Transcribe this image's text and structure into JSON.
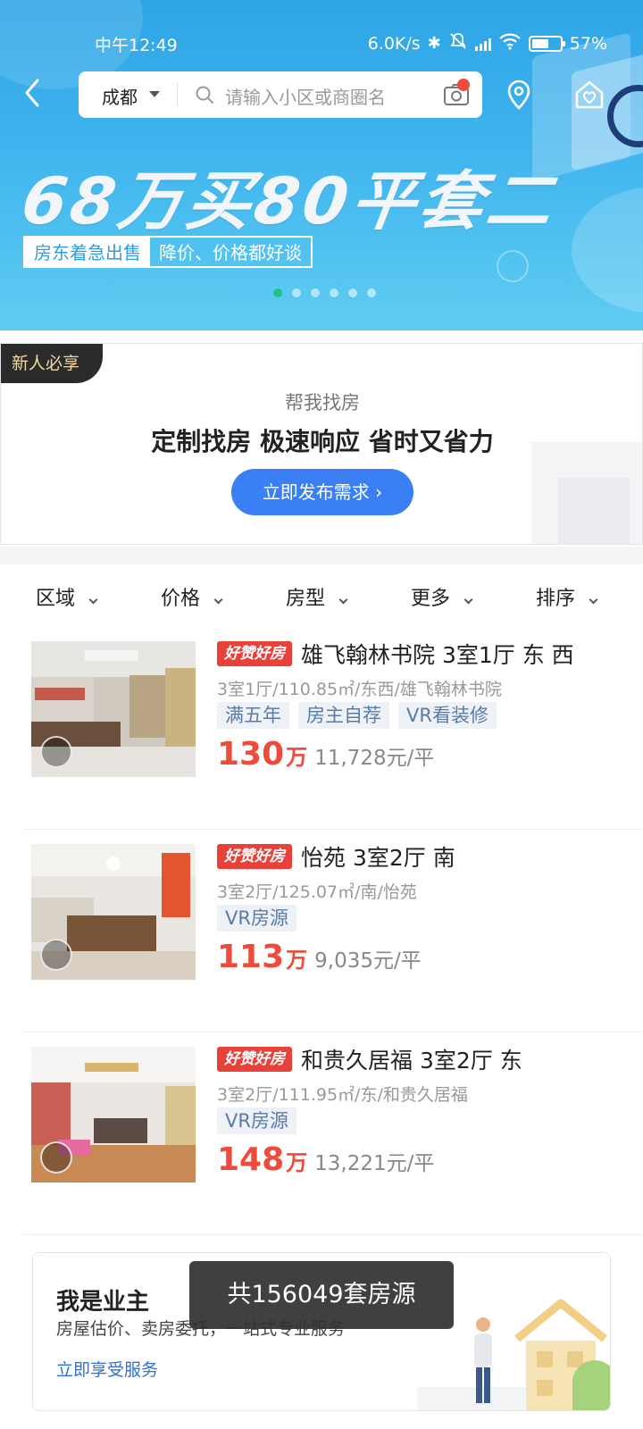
{
  "status_bar": {
    "time": "中午12:49",
    "net_speed": "6.0K/s",
    "battery": "57%"
  },
  "header": {
    "city": "成都",
    "search_placeholder": "请输入小区或商圈名"
  },
  "banner": {
    "headline": "68万买80平套二",
    "tag_left": "房东着急出售",
    "tag_right": "降价、价格都好谈",
    "carousel_total": 6,
    "carousel_active": 1
  },
  "promo": {
    "badge": "新人必享",
    "subtitle": "帮我找房",
    "title": "定制找房 极速响应 省时又省力",
    "button": "立即发布需求 ›"
  },
  "filters": [
    "区域",
    "价格",
    "房型",
    "更多",
    "排序"
  ],
  "listings": [
    {
      "badge": "好赞好房",
      "title": "雄飞翰林书院 3室1厅 东 西",
      "meta": "3室1厅/110.85㎡/东西/雄飞翰林书院",
      "tags": [
        "满五年",
        "房主自荐",
        "VR看装修"
      ],
      "price": "130",
      "price_unit": "万",
      "unit_price": "11,728元/平"
    },
    {
      "badge": "好赞好房",
      "title": "怡苑 3室2厅 南",
      "meta": "3室2厅/125.07㎡/南/怡苑",
      "tags": [
        "VR房源"
      ],
      "price": "113",
      "price_unit": "万",
      "unit_price": "9,035元/平"
    },
    {
      "badge": "好赞好房",
      "title": "和贵久居福 3室2厅 东",
      "meta": "3室2厅/111.95㎡/东/和贵久居福",
      "tags": [
        "VR房源"
      ],
      "price": "148",
      "price_unit": "万",
      "unit_price": "13,221元/平"
    }
  ],
  "owner_card": {
    "title": "我是业主",
    "subtitle": "房屋估价、卖房委托，一站式专业服务",
    "link": "立即享受服务"
  },
  "toast": "共156049套房源",
  "colors": {
    "brand_blue": "#3a7ff4",
    "price_red": "#ee4b3a",
    "carousel_active": "#1fc28a"
  }
}
